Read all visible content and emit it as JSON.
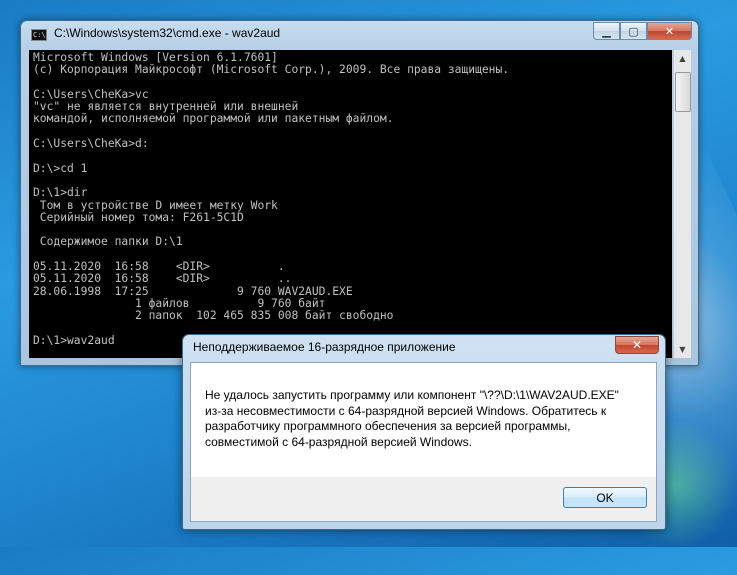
{
  "cmd_window": {
    "title": "C:\\Windows\\system32\\cmd.exe - wav2aud",
    "icon": "cmd-icon",
    "icon_text": "C:\\",
    "console_lines": [
      "Microsoft Windows [Version 6.1.7601]",
      "(c) Корпорация Майкрософт (Microsoft Corp.), 2009. Все права защищены.",
      "",
      "C:\\Users\\CheKa>vc",
      "\"vc\" не является внутренней или внешней",
      "командой, исполняемой программой или пакетным файлом.",
      "",
      "C:\\Users\\CheKa>d:",
      "",
      "D:\\>cd 1",
      "",
      "D:\\1>dir",
      " Том в устройстве D имеет метку Work",
      " Серийный номер тома: F261-5C1D",
      "",
      " Содержимое папки D:\\1",
      "",
      "05.11.2020  16:58    <DIR>          .",
      "05.11.2020  16:58    <DIR>          ..",
      "28.06.1998  17:25             9 760 WAV2AUD.EXE",
      "               1 файлов          9 760 байт",
      "               2 папок  102 465 835 008 байт свободно",
      "",
      "D:\\1>wav2aud"
    ],
    "buttons": {
      "minimize": "▁",
      "maximize": "▢",
      "close": "✕"
    }
  },
  "dialog": {
    "title": "Неподдерживаемое 16-разрядное приложение",
    "close": "✕",
    "message_lines": [
      "Не удалось запустить программу или компонент \"\\??\\D:\\1\\WAV2AUD.EXE\"",
      "из-за несовместимости с 64-разрядной версией Windows. Обратитесь к",
      "разработчику программного обеспечения за версией программы,",
      "совместимой с 64-разрядной версией Windows."
    ],
    "ok_label": "OK"
  },
  "colors": {
    "console_bg": "#000000",
    "console_fg": "#c0c0c0",
    "desktop": "#1f86cf"
  }
}
